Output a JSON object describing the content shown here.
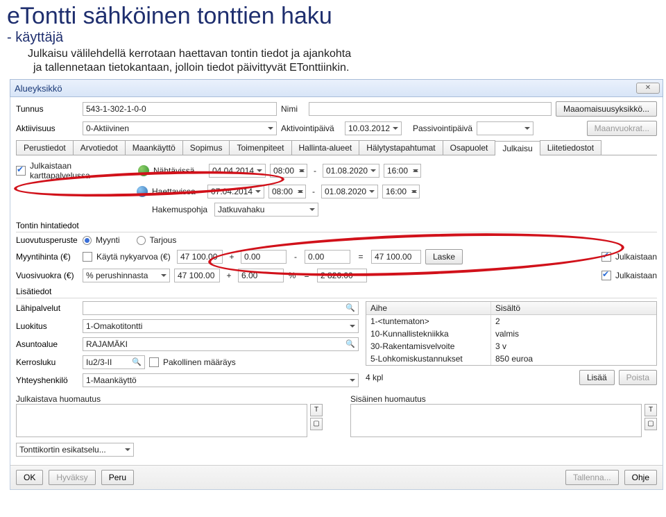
{
  "slide": {
    "title": "eTontti sähköinen tonttien haku",
    "subtitle": "- käyttäjä",
    "desc1": "Julkaisu välilehdellä kerrotaan haettavan tontin tiedot ja ajankohta",
    "desc2": "ja tallennetaan tietokantaan, jolloin tiedot päivittyvät ETonttiinkin."
  },
  "win": {
    "title": "Alueyksikkö",
    "close": "✕"
  },
  "top": {
    "tunnus_label": "Tunnus",
    "tunnus": "543-1-302-1-0-0",
    "nimi_label": "Nimi",
    "nimi": "",
    "maaomaisuus_btn": "Maaomaisuusyksikkö...",
    "aktiivisuus_label": "Aktiivisuus",
    "aktiivisuus": "0-Aktiivinen",
    "aktivointi_label": "Aktivointipäivä",
    "aktivointi": "10.03.2012",
    "passivointi_label": "Passivointipäivä",
    "passivointi": "",
    "maanvuokrat_btn": "Maanvuokrat..."
  },
  "tabs": [
    "Perustiedot",
    "Arvotiedot",
    "Maankäyttö",
    "Sopimus",
    "Toimenpiteet",
    "Hallinta-alueet",
    "Hälytystapahtumat",
    "Osapuolet",
    "Julkaisu",
    "Liitetiedostot"
  ],
  "pub": {
    "karttapalvelu_label": "Julkaistaan karttapalvelussa",
    "nahtavissa_label": "Nähtävissä",
    "nahtavissa_start_date": "04.04.2014",
    "nahtavissa_start_time": "08:00",
    "nahtavissa_end_date": "01.08.2020",
    "nahtavissa_end_time": "16:00",
    "haettavissa_label": "Haettavissa",
    "haettavissa_start_date": "07.04.2014",
    "haettavissa_start_time": "08:00",
    "haettavissa_end_date": "01.08.2020",
    "haettavissa_end_time": "16:00",
    "hakemuspohja_label": "Hakemuspohja",
    "hakemuspohja": "Jatkuvahaku"
  },
  "price": {
    "section": "Tontin hintatiedot",
    "luovutusperuste_label": "Luovutusperuste",
    "myynti": "Myynti",
    "tarjous": "Tarjous",
    "myyntihinta_label": "Myyntihinta (€)",
    "nykyarvo_label": "Käytä nykyarvoa (€)",
    "mh1": "47 100.00",
    "mh_plus": "0.00",
    "mh_minus": "0.00",
    "mh_eq": "47 100.00",
    "laske_btn": "Laske",
    "julkaistaan": "Julkaistaan",
    "vuosivuokra_label": "Vuosivuokra (€)",
    "vuokraperuste": "% perushinnasta",
    "vv1": "47 100.00",
    "vv_plus": "6.00",
    "vv_eq": "2 826.00"
  },
  "extra": {
    "section": "Lisätiedot",
    "lahipalvelut_label": "Lähipalvelut",
    "lahipalvelut": "",
    "aihe_head": "Aihe",
    "sisalto_head": "Sisältö",
    "rows": [
      {
        "a": "1-<tuntematon>",
        "b": "2"
      },
      {
        "a": "10-Kunnallistekniikka",
        "b": "valmis"
      },
      {
        "a": "30-Rakentamisvelvoite",
        "b": "3 v"
      },
      {
        "a": "5-Lohkomiskustannukset",
        "b": "850 euroa"
      }
    ],
    "luokitus_label": "Luokitus",
    "luokitus": "1-Omakotitontti",
    "asuntoalue_label": "Asuntoalue",
    "asuntoalue": "RAJAMÄKI",
    "kerrosluku_label": "Kerrosluku",
    "kerrosluku": "Iu2/3-II",
    "pakollinen_label": "Pakollinen määräys",
    "yhteys_label": "Yhteyshenkilö",
    "yhteys": "1-Maankäyttö",
    "count": "4 kpl",
    "lisaa": "Lisää",
    "poista": "Poista",
    "julk_huom_label": "Julkaistava huomautus",
    "sis_huom_label": "Sisäinen huomautus"
  },
  "footer": {
    "kortti": "Tonttikortin esikatselu...",
    "ok": "OK",
    "hyvaksy": "Hyväksy",
    "peru": "Peru",
    "tallenna": "Tallenna...",
    "ohje": "Ohje"
  }
}
